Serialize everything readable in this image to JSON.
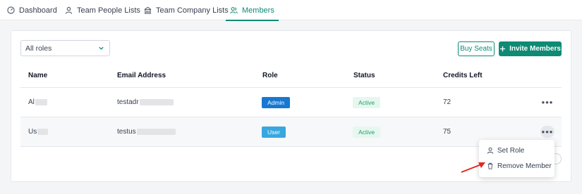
{
  "tabs": [
    {
      "label": "Dashboard",
      "icon": "dashboard-icon",
      "active": false
    },
    {
      "label": "Team People Lists",
      "icon": "person-icon",
      "active": false
    },
    {
      "label": "Team Company Lists",
      "icon": "building-icon",
      "active": false
    },
    {
      "label": "Members",
      "icon": "members-icon",
      "active": true
    }
  ],
  "filter": {
    "selected": "All roles"
  },
  "actions": {
    "buy_seats": "Buy Seats",
    "invite": "Invite Members"
  },
  "table": {
    "headers": {
      "name": "Name",
      "email": "Email Address",
      "role": "Role",
      "status": "Status",
      "credits": "Credits Left"
    },
    "rows": [
      {
        "name": "Al",
        "email": "testadr",
        "role": "Admin",
        "status": "Active",
        "credits": "72"
      },
      {
        "name": "Us",
        "email": "testus",
        "role": "User",
        "status": "Active",
        "credits": "75"
      }
    ]
  },
  "menu": {
    "set_role": "Set Role",
    "remove_member": "Remove Member"
  },
  "colors": {
    "accent": "#0f8a74",
    "admin": "#1678d1",
    "user": "#38a7e0",
    "active_bg": "#e6f7ef",
    "active_text": "#22a06b",
    "arrow": "#e8241f"
  }
}
